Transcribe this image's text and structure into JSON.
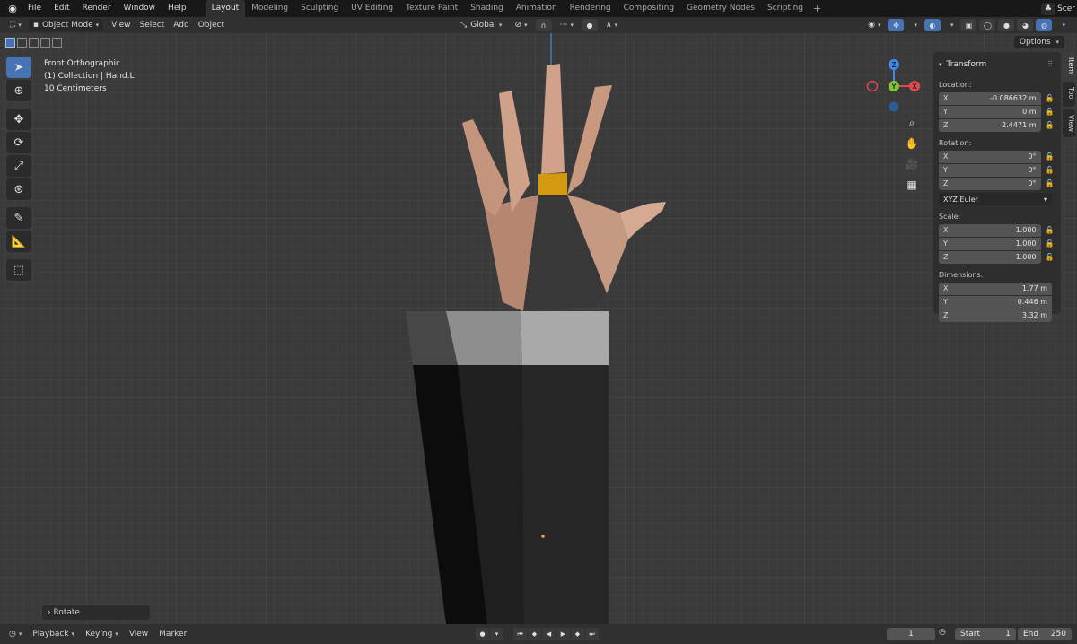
{
  "menu": [
    "File",
    "Edit",
    "Render",
    "Window",
    "Help"
  ],
  "workspaces": [
    "Layout",
    "Modeling",
    "Sculpting",
    "UV Editing",
    "Texture Paint",
    "Shading",
    "Animation",
    "Rendering",
    "Compositing",
    "Geometry Nodes",
    "Scripting"
  ],
  "active_workspace": "Layout",
  "add_workspace": "+",
  "scene_label": "Scer",
  "viewport_header": {
    "mode": "Object Mode",
    "menus": [
      "View",
      "Select",
      "Add",
      "Object"
    ],
    "orientation": "Global"
  },
  "options_label": "Options",
  "overlay": {
    "view_name": "Front Orthographic",
    "collection": "(1) Collection | Hand.L",
    "scale": "10 Centimeters"
  },
  "gizmo": {
    "z": "Z",
    "y": "Y",
    "x": "X"
  },
  "npanel": {
    "title": "Transform",
    "location_label": "Location:",
    "location": [
      {
        "axis": "X",
        "value": "-0.086632 m"
      },
      {
        "axis": "Y",
        "value": "0 m"
      },
      {
        "axis": "Z",
        "value": "2.4471 m"
      }
    ],
    "rotation_label": "Rotation:",
    "rotation": [
      {
        "axis": "X",
        "value": "0°"
      },
      {
        "axis": "Y",
        "value": "0°"
      },
      {
        "axis": "Z",
        "value": "0°"
      }
    ],
    "rotation_mode": "XYZ Euler",
    "scale_label": "Scale:",
    "scale": [
      {
        "axis": "X",
        "value": "1.000"
      },
      {
        "axis": "Y",
        "value": "1.000"
      },
      {
        "axis": "Z",
        "value": "1.000"
      }
    ],
    "dimensions_label": "Dimensions:",
    "dimensions": [
      {
        "axis": "X",
        "value": "1.77 m"
      },
      {
        "axis": "Y",
        "value": "0.446 m"
      },
      {
        "axis": "Z",
        "value": "3.32 m"
      }
    ]
  },
  "sidebar_tabs": [
    "Item",
    "Tool",
    "View"
  ],
  "last_operator": "Rotate",
  "timeline": {
    "menus": [
      "Playback",
      "Keying",
      "View",
      "Marker"
    ],
    "current_frame": "1",
    "start_label": "Start",
    "start": "1",
    "end_label": "End",
    "end": "250"
  },
  "colors": {
    "accent": "#4772b3",
    "axis_x": "#e04a55",
    "axis_y": "#7ec63a",
    "axis_z": "#3f8ae0",
    "skin": "#c4957d",
    "sleeve": "#2b2b2b",
    "wrist_band": "#d39a0f"
  }
}
